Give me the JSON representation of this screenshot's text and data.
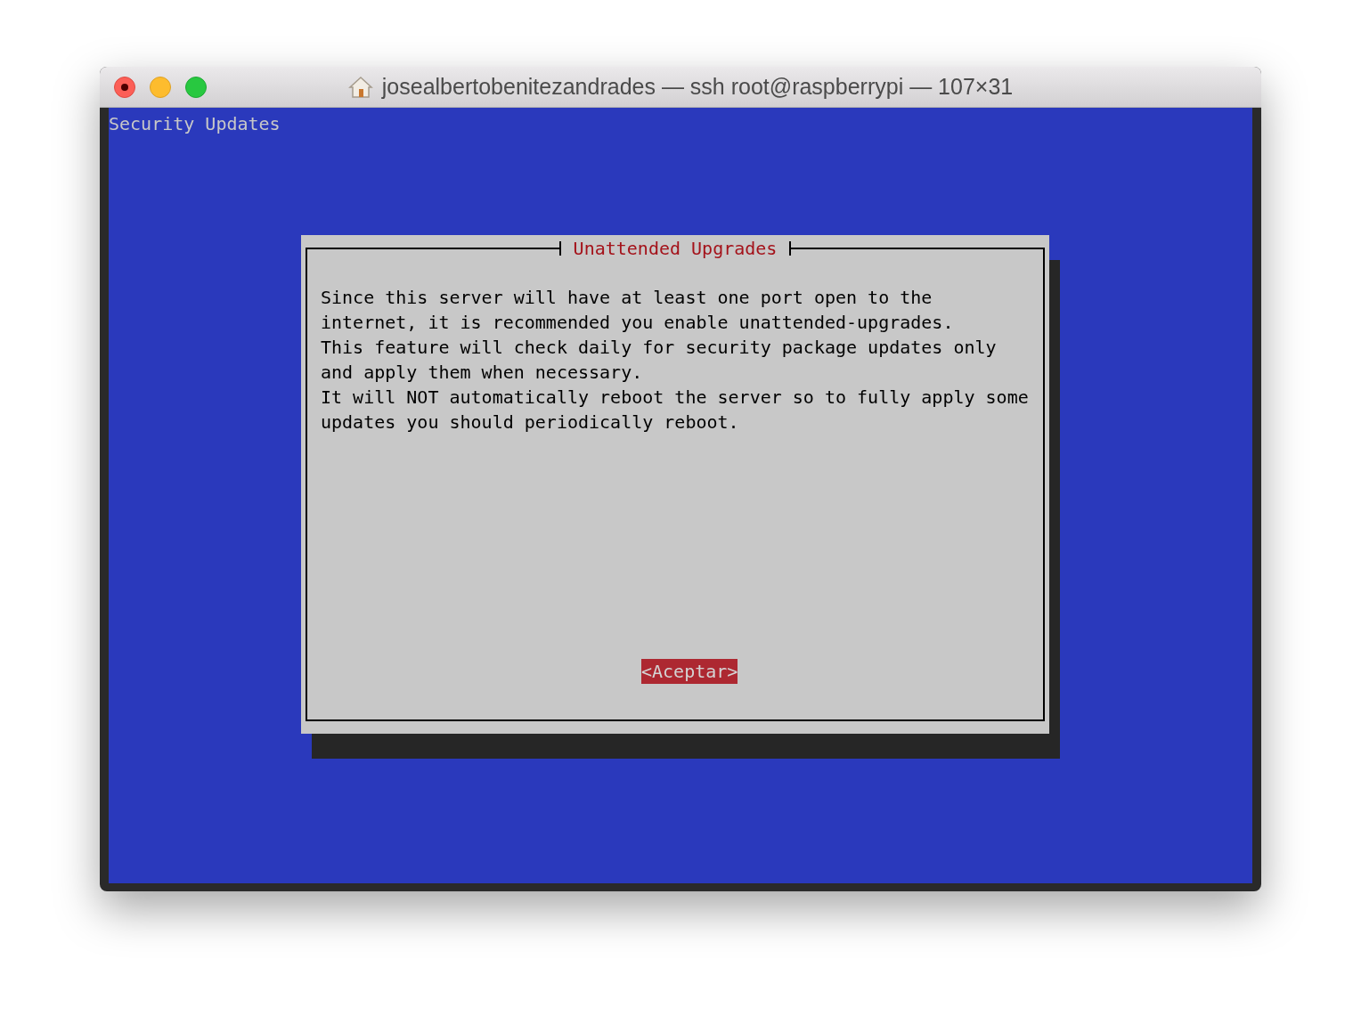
{
  "window": {
    "title": "josealbertobenitezandrades — ssh root@raspberrypi — 107×31"
  },
  "terminal": {
    "header": "Security Updates",
    "dialog": {
      "title": "Unattended Upgrades",
      "message_lines": [
        "Since this server will have at least one port open to the",
        "internet, it is recommended you enable unattended-upgrades.",
        "This feature will check daily for security package updates only",
        "and apply them when necessary.",
        "It will NOT automatically reboot the server so to fully apply some",
        "updates you should periodically reboot."
      ],
      "buttons": [
        {
          "label": "<Aceptar>",
          "selected": true
        }
      ]
    }
  }
}
